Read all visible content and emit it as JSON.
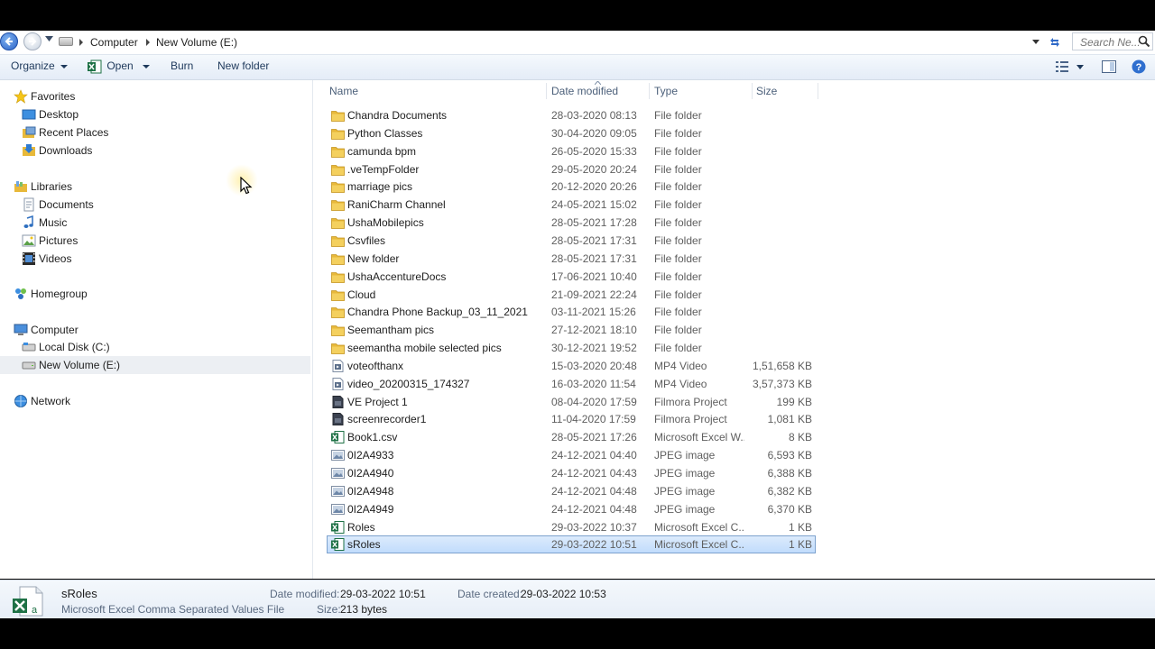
{
  "address": {
    "breadcrumb": [
      "Computer",
      "New Volume (E:)"
    ],
    "search_placeholder": "Search Ne..."
  },
  "toolbar": {
    "organize": "Organize",
    "open": "Open",
    "burn": "Burn",
    "new_folder": "New folder"
  },
  "nav": {
    "favorites": "Favorites",
    "desktop": "Desktop",
    "recent_places": "Recent Places",
    "downloads": "Downloads",
    "libraries": "Libraries",
    "documents": "Documents",
    "music": "Music",
    "pictures": "Pictures",
    "videos": "Videos",
    "homegroup": "Homegroup",
    "computer": "Computer",
    "local_disk": "Local Disk (C:)",
    "new_volume": "New Volume (E:)",
    "network": "Network"
  },
  "columns": {
    "name": "Name",
    "date_modified": "Date modified",
    "type": "Type",
    "size": "Size"
  },
  "files": [
    {
      "name": "Chandra Documents",
      "date": "28-03-2020 08:13",
      "type": "File folder",
      "size": "",
      "icon": "folder"
    },
    {
      "name": "Python Classes",
      "date": "30-04-2020 09:05",
      "type": "File folder",
      "size": "",
      "icon": "folder"
    },
    {
      "name": "camunda bpm",
      "date": "26-05-2020 15:33",
      "type": "File folder",
      "size": "",
      "icon": "folder"
    },
    {
      "name": ".veTempFolder",
      "date": "29-05-2020 20:24",
      "type": "File folder",
      "size": "",
      "icon": "folder"
    },
    {
      "name": "marriage pics",
      "date": "20-12-2020 20:26",
      "type": "File folder",
      "size": "",
      "icon": "folder"
    },
    {
      "name": "RaniCharm Channel",
      "date": "24-05-2021 15:02",
      "type": "File folder",
      "size": "",
      "icon": "folder"
    },
    {
      "name": "UshaMobilepics",
      "date": "28-05-2021 17:28",
      "type": "File folder",
      "size": "",
      "icon": "folder"
    },
    {
      "name": "Csvfiles",
      "date": "28-05-2021 17:31",
      "type": "File folder",
      "size": "",
      "icon": "folder"
    },
    {
      "name": "New folder",
      "date": "28-05-2021 17:31",
      "type": "File folder",
      "size": "",
      "icon": "folder"
    },
    {
      "name": "UshaAccentureDocs",
      "date": "17-06-2021 10:40",
      "type": "File folder",
      "size": "",
      "icon": "folder"
    },
    {
      "name": "Cloud",
      "date": "21-09-2021 22:24",
      "type": "File folder",
      "size": "",
      "icon": "folder"
    },
    {
      "name": "Chandra Phone Backup_03_11_2021",
      "date": "03-11-2021 15:26",
      "type": "File folder",
      "size": "",
      "icon": "folder"
    },
    {
      "name": "Seemantham pics",
      "date": "27-12-2021 18:10",
      "type": "File folder",
      "size": "",
      "icon": "folder"
    },
    {
      "name": "seemantha mobile selected pics",
      "date": "30-12-2021 19:52",
      "type": "File folder",
      "size": "",
      "icon": "folder"
    },
    {
      "name": "voteofthanx",
      "date": "15-03-2020 20:48",
      "type": "MP4 Video",
      "size": "1,51,658 KB",
      "icon": "video"
    },
    {
      "name": "video_20200315_174327",
      "date": "16-03-2020 11:54",
      "type": "MP4 Video",
      "size": "3,57,373 KB",
      "icon": "video"
    },
    {
      "name": "VE Project 1",
      "date": "08-04-2020 17:59",
      "type": "Filmora Project",
      "size": "199 KB",
      "icon": "filmora"
    },
    {
      "name": "screenrecorder1",
      "date": "11-04-2020 17:59",
      "type": "Filmora Project",
      "size": "1,081 KB",
      "icon": "filmora"
    },
    {
      "name": "Book1.csv",
      "date": "28-05-2021 17:26",
      "type": "Microsoft Excel W...",
      "size": "8 KB",
      "icon": "excel"
    },
    {
      "name": "0I2A4933",
      "date": "24-12-2021 04:40",
      "type": "JPEG image",
      "size": "6,593 KB",
      "icon": "image"
    },
    {
      "name": "0I2A4940",
      "date": "24-12-2021 04:43",
      "type": "JPEG image",
      "size": "6,388 KB",
      "icon": "image"
    },
    {
      "name": "0I2A4948",
      "date": "24-12-2021 04:48",
      "type": "JPEG image",
      "size": "6,382 KB",
      "icon": "image"
    },
    {
      "name": "0I2A4949",
      "date": "24-12-2021 04:48",
      "type": "JPEG image",
      "size": "6,370 KB",
      "icon": "image"
    },
    {
      "name": "Roles",
      "date": "29-03-2022 10:37",
      "type": "Microsoft Excel C...",
      "size": "1 KB",
      "icon": "excel"
    },
    {
      "name": "sRoles",
      "date": "29-03-2022 10:51",
      "type": "Microsoft Excel C...",
      "size": "1 KB",
      "icon": "excel",
      "selected": true
    }
  ],
  "details": {
    "name": "sRoles",
    "type": "Microsoft Excel Comma Separated Values File",
    "date_modified_label": "Date modified:",
    "date_modified": "29-03-2022 10:51",
    "size_label": "Size:",
    "size": "213 bytes",
    "date_created_label": "Date created:",
    "date_created": "29-03-2022 10:53"
  },
  "colors": {
    "selection": "#cce4fc",
    "folder": "#e8b93a",
    "excel_green": "#1e7145"
  }
}
